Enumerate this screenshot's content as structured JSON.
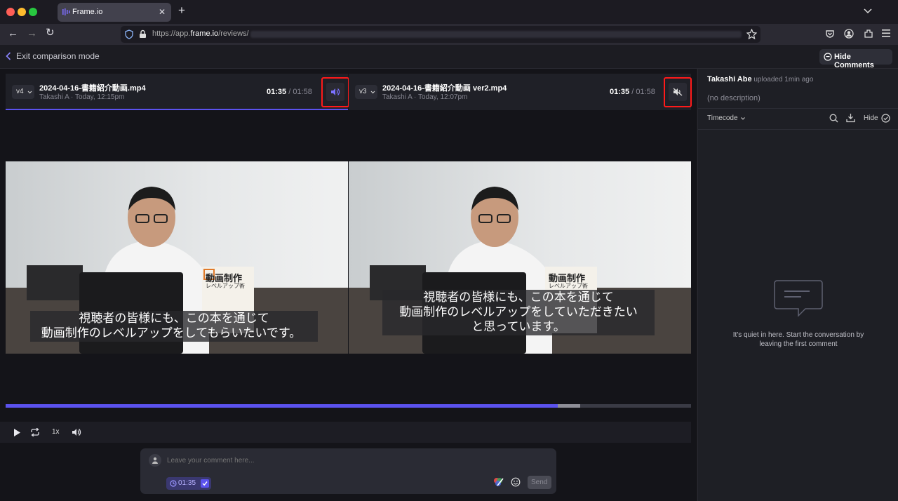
{
  "browser": {
    "tab_title": "Frame.io",
    "new_tab": "+",
    "url_prefix": "https://app.",
    "url_domain": "frame.io",
    "url_path": "/reviews/"
  },
  "header": {
    "exit_label": "Exit comparison mode",
    "hide_comments_label": "Hide Comments"
  },
  "left_video": {
    "version": "v4",
    "filename": "2024-04-16-書籍紹介動画.mp4",
    "meta": "Takashi A · Today, 12:15pm",
    "current_time": "01:35",
    "separator": " / ",
    "duration": "01:58",
    "audio_state": "unmuted",
    "book_title": "動画制作",
    "book_subtitle": "レベルアップ術",
    "subtitle_lines": [
      "視聴者の皆様にも、この本を通じて",
      "動画制作のレベルアップをしてもらいたいです。"
    ]
  },
  "right_video": {
    "version": "v3",
    "filename": "2024-04-16-書籍紹介動画 ver2.mp4",
    "meta": "Takashi A · Today, 12:07pm",
    "current_time": "01:35",
    "separator": " / ",
    "duration": "01:58",
    "audio_state": "muted",
    "book_title": "動画制作",
    "book_subtitle": "レベルアップ術",
    "subtitle_lines": [
      "視聴者の皆様にも、この本を通じて",
      "動画制作のレベルアップをしていただきたい",
      "と思っています。"
    ]
  },
  "timeline": {
    "progress": 0.806,
    "buffered": 0.838
  },
  "controls": {
    "speed": "1x"
  },
  "composer": {
    "placeholder": "Leave your comment here...",
    "timestamp": "01:35",
    "send_label": "Send"
  },
  "sidebar": {
    "uploader_name": "Takashi Abe",
    "uploaded_text": " uploaded 1min ago",
    "description": "(no description)",
    "sort_label": "Timecode",
    "hide_label": "Hide",
    "empty_line1": "It's quiet in here. Start the conversation by",
    "empty_line2": "leaving the first comment"
  },
  "colors": {
    "accent": "#5b52ee",
    "highlight": "#ff1a1a"
  }
}
